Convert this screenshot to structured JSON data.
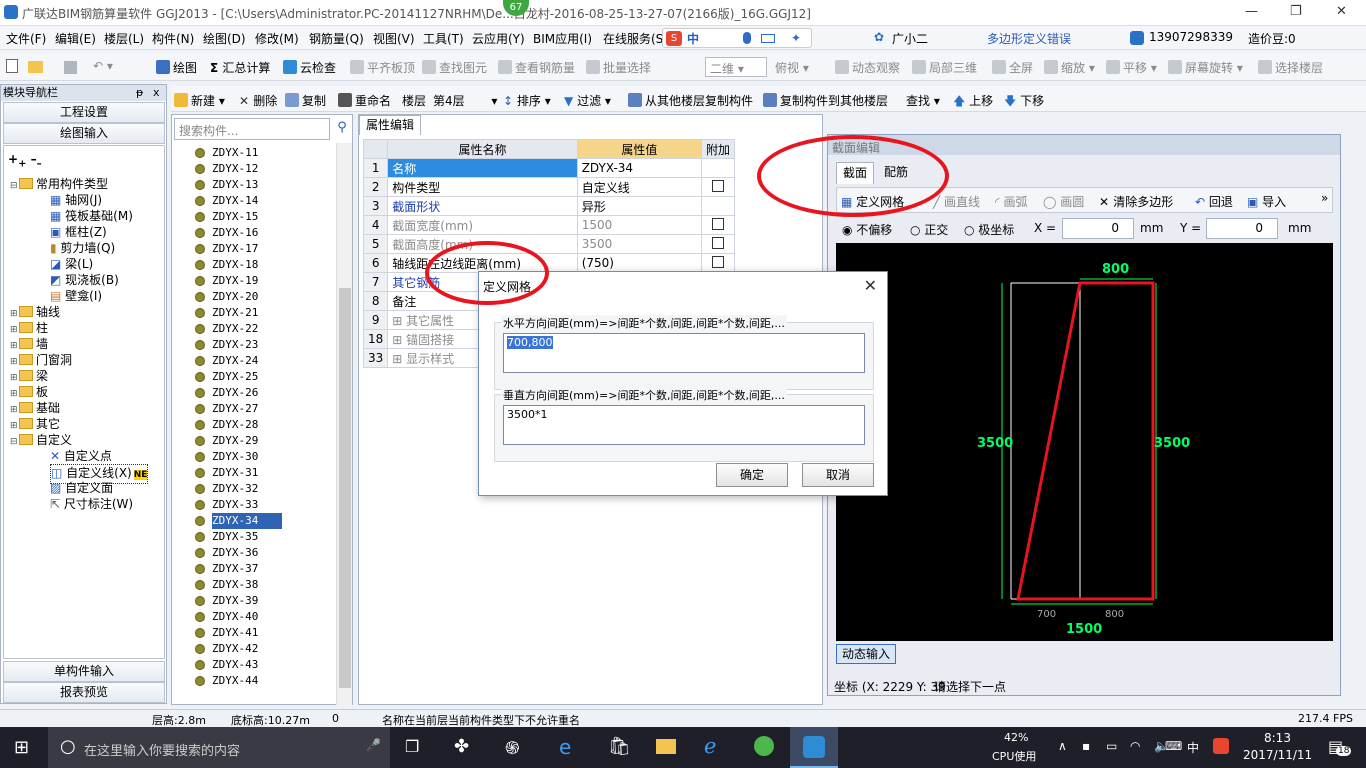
{
  "window": {
    "title": "广联达BIM钢筋算量软件 GGJ2013 - [C:\\Users\\Administrator.PC-20141127NRHM\\De...白龙村-2016-08-25-13-27-07(2166版)_16G.GGJ12]",
    "badge": "67",
    "min": "—",
    "max": "❐",
    "close": "✕"
  },
  "menu": {
    "items": [
      "文件(F)",
      "编辑(E)",
      "楼层(L)",
      "构件(N)",
      "绘图(D)",
      "修改(M)",
      "钢筋量(Q)",
      "视图(V)",
      "工具(T)",
      "云应用(Y)",
      "BIM应用(I)",
      "在线服务(S)"
    ],
    "ime_label": "中",
    "error_msg": "多边形定义错误",
    "phone": "13907298339",
    "cost_beans": "造价豆:0",
    "guangxiao": "广小二"
  },
  "toolbar1": {
    "items": [
      "绘图",
      "汇总计算",
      "云检查",
      "平齐板顶",
      "查找图元",
      "查看钢筋量",
      "批量选择",
      "二维",
      "俯视",
      "动态观察",
      "局部三维",
      "全屏",
      "缩放",
      "平移",
      "屏幕旋转",
      "选择楼层"
    ]
  },
  "toolbar2": {
    "items": [
      "新建",
      "删除",
      "复制",
      "重命名",
      "楼层",
      "第4层",
      "排序",
      "过滤",
      "从其他楼层复制构件",
      "复制构件到其他楼层",
      "查找",
      "上移",
      "下移"
    ]
  },
  "nav": {
    "header": "模块导航栏",
    "pin": "ᵽ",
    "close": "x",
    "btn_project": "工程设置",
    "btn_draw": "绘图输入",
    "btn_single": "单构件输入",
    "btn_report": "报表预览",
    "tree": [
      {
        "label": "常用构件类型",
        "level": 0,
        "toggle": "⊟"
      },
      {
        "label": "轴网(J)",
        "level": 1
      },
      {
        "label": "筏板基础(M)",
        "level": 1
      },
      {
        "label": "框柱(Z)",
        "level": 1
      },
      {
        "label": "剪力墙(Q)",
        "level": 1
      },
      {
        "label": "梁(L)",
        "level": 1
      },
      {
        "label": "现浇板(B)",
        "level": 1
      },
      {
        "label": "壁龛(I)",
        "level": 1
      },
      {
        "label": "轴线",
        "level": 0,
        "toggle": "⊞"
      },
      {
        "label": "柱",
        "level": 0,
        "toggle": "⊞"
      },
      {
        "label": "墙",
        "level": 0,
        "toggle": "⊞"
      },
      {
        "label": "门窗洞",
        "level": 0,
        "toggle": "⊞"
      },
      {
        "label": "梁",
        "level": 0,
        "toggle": "⊞"
      },
      {
        "label": "板",
        "level": 0,
        "toggle": "⊞"
      },
      {
        "label": "基础",
        "level": 0,
        "toggle": "⊞"
      },
      {
        "label": "其它",
        "level": 0,
        "toggle": "⊞"
      },
      {
        "label": "自定义",
        "level": 0,
        "toggle": "⊟"
      },
      {
        "label": "自定义点",
        "level": 1
      },
      {
        "label": "自定义线(X)",
        "level": 1
      },
      {
        "label": "自定义面",
        "level": 1
      },
      {
        "label": "尺寸标注(W)",
        "level": 1
      }
    ],
    "new_tag": "NE"
  },
  "list": {
    "search_placeholder": "搜索构件...",
    "items": [
      "ZDYX-11",
      "ZDYX-12",
      "ZDYX-13",
      "ZDYX-14",
      "ZDYX-15",
      "ZDYX-16",
      "ZDYX-17",
      "ZDYX-18",
      "ZDYX-19",
      "ZDYX-20",
      "ZDYX-21",
      "ZDYX-22",
      "ZDYX-23",
      "ZDYX-24",
      "ZDYX-25",
      "ZDYX-26",
      "ZDYX-27",
      "ZDYX-28",
      "ZDYX-29",
      "ZDYX-30",
      "ZDYX-31",
      "ZDYX-32",
      "ZDYX-33",
      "ZDYX-34",
      "ZDYX-35",
      "ZDYX-36",
      "ZDYX-37",
      "ZDYX-38",
      "ZDYX-39",
      "ZDYX-40",
      "ZDYX-41",
      "ZDYX-42",
      "ZDYX-43",
      "ZDYX-44"
    ],
    "selected": "ZDYX-34"
  },
  "props": {
    "tab": "属性编辑",
    "col_name": "属性名称",
    "col_value": "属性值",
    "col_extra": "附加",
    "rows": [
      {
        "num": "1",
        "name": "名称",
        "value": "ZDYX-34"
      },
      {
        "num": "2",
        "name": "构件类型",
        "value": "自定义线"
      },
      {
        "num": "3",
        "name": "截面形状",
        "value": "异形"
      },
      {
        "num": "4",
        "name": "截面宽度(mm)",
        "value": "1500"
      },
      {
        "num": "5",
        "name": "截面高度(mm)",
        "value": "3500"
      },
      {
        "num": "6",
        "name": "轴线距左边线距离(mm)",
        "value": "(750)"
      },
      {
        "num": "7",
        "name": "其它钢筋",
        "value": ""
      },
      {
        "num": "8",
        "name": "备注",
        "value": ""
      },
      {
        "num": "9",
        "name": "其它属性",
        "value": ""
      },
      {
        "num": "18",
        "name": "锚固搭接",
        "value": ""
      },
      {
        "num": "33",
        "name": "显示样式",
        "value": ""
      }
    ]
  },
  "section": {
    "header": "截面编辑",
    "tab_section": "截面",
    "tab_rebar": "配筋",
    "tools": [
      "定义网格",
      "画直线",
      "画弧",
      "画圆",
      "清除多边形",
      "回退",
      "导入"
    ],
    "more": "»",
    "opt_no_offset": "不偏移",
    "opt_ortho": "正交",
    "opt_polar": "极坐标",
    "x_label": "X =",
    "x_value": "0",
    "y_label": "Y =",
    "y_value": "0",
    "unit": "mm",
    "dims": {
      "top": "800",
      "left": "3500",
      "right": "3500",
      "bottom_left": "700",
      "bottom_right": "800",
      "bottom_total": "1500"
    },
    "dynamic_input": "动态输入",
    "coords": "坐标 (X: 2229 Y: 39",
    "prompt": "请选择下一点"
  },
  "dialog": {
    "title": "定义网格",
    "h_label": "水平方向间距(mm)=>间距*个数,间距,间距*个数,间距,...",
    "h_value": "700,800",
    "v_label": "垂直方向间距(mm)=>间距*个数,间距,间距*个数,间距,...",
    "v_value": "3500*1",
    "ok": "确定",
    "cancel": "取消",
    "close": "✕"
  },
  "status": {
    "floor_height": "层高:2.8m",
    "base_height": "底标高:10.27m",
    "zero": "0",
    "message": "名称在当前层当前构件类型下不允许重名",
    "fps": "217.4 FPS"
  },
  "taskbar": {
    "search_placeholder": "在这里输入你要搜索的内容",
    "cpu_percent": "42%",
    "cpu_label": "CPU使用",
    "lang": "中",
    "time": "8:13",
    "date": "2017/11/11",
    "notify_count": "18"
  }
}
